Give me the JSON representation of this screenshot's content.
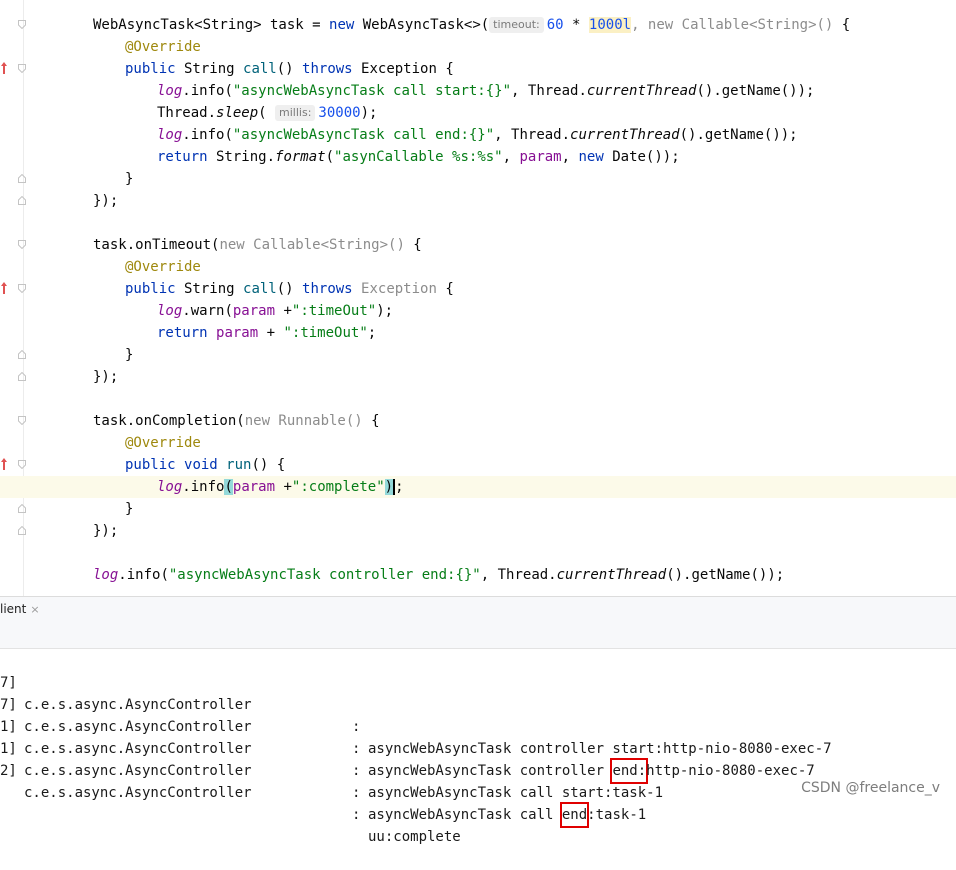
{
  "editor": {
    "lines": {
      "l1": {
        "a": "WebAsyncTask<String> task = ",
        "b": "new",
        "c": " WebAsyncTask<>(",
        "hint": "timeout:",
        "d": "60",
        "e": " * ",
        "f": "1000l",
        "g": ", ",
        "h": "new Callable<String>()",
        "i": " {"
      },
      "l2": {
        "ann": "@Override"
      },
      "l3": {
        "a": "public",
        "b": " String ",
        "c": "call",
        "d": "() ",
        "e": "throws",
        "f": " Exception {"
      },
      "l4": {
        "a": "log",
        "b": ".info(",
        "c": "\"asyncWebAsyncTask call start:{}\"",
        "d": ", Thread.",
        "e": "currentThread",
        "f": "().getName());"
      },
      "l5": {
        "a": "Thread.",
        "b": "sleep",
        "c": "( ",
        "hint": "millis:",
        "d": "30000",
        "e": ");"
      },
      "l6": {
        "a": "log",
        "b": ".info(",
        "c": "\"asyncWebAsyncTask call end:{}\"",
        "d": ", Thread.",
        "e": "currentThread",
        "f": "().getName());"
      },
      "l7": {
        "a": "return",
        "b": " String.",
        "c": "format",
        "d": "(",
        "e": "\"asynCallable %s:%s\"",
        "f": ", ",
        "g": "param",
        "h": ", ",
        "i": "new",
        "j": " Date());"
      },
      "l8": {
        "a": "}"
      },
      "l9": {
        "a": "});"
      },
      "l10": {
        "a": "task.onTimeout(",
        "b": "new Callable<String>()",
        "c": " {"
      },
      "l11": {
        "ann": "@Override"
      },
      "l12": {
        "a": "public",
        "b": " String ",
        "c": "call",
        "d": "() ",
        "e": "throws",
        "f": " Exception",
        "g": " {"
      },
      "l13": {
        "a": "log",
        "b": ".warn(",
        "c": "param",
        "d": " +",
        "e": "\":timeOut\"",
        "f": ");"
      },
      "l14": {
        "a": "return",
        "b": " ",
        "c": "param",
        "d": " + ",
        "e": "\":timeOut\"",
        "f": ";"
      },
      "l15": {
        "a": "}"
      },
      "l16": {
        "a": "});"
      },
      "l17": {
        "a": "task.onCompletion(",
        "b": "new Runnable()",
        "c": " {"
      },
      "l18": {
        "ann": "@Override"
      },
      "l19": {
        "a": "public",
        "b": " ",
        "c": "void",
        "d": " ",
        "e": "run",
        "f": "() {"
      },
      "l20": {
        "a": "log",
        "b": ".info",
        "c": "(",
        "d": "param",
        "e": " +",
        "f": "\":complete\"",
        "g": ")",
        "h": ";"
      },
      "l21": {
        "a": "}"
      },
      "l22": {
        "a": "});"
      },
      "l23": {
        "a": "log",
        "b": ".info(",
        "c": "\"asyncWebAsyncTask controller end:{}\"",
        "d": ", Thread.",
        "e": "currentThread",
        "f": "().getName());"
      }
    }
  },
  "tool_window": {
    "tab_label": "lient",
    "close_glyph": "×"
  },
  "console": {
    "rows": [
      {
        "thread": "7]",
        "logger": "c.e.s.async.AsyncController",
        "colon": ":",
        "msg": "asyncWebAsyncTask controller start:http-nio-8080-exec-7"
      },
      {
        "thread": "7]",
        "logger": "c.e.s.async.AsyncController",
        "colon": ":",
        "msg_pre": "asyncWebAsyncTask controller ",
        "msg_box": "end:",
        "msg_post": "http-nio-8080-exec-7"
      },
      {
        "thread": "1]",
        "logger": "c.e.s.async.AsyncController",
        "colon": ":",
        "msg": "asyncWebAsyncTask call start:task-1"
      },
      {
        "thread": "1]",
        "logger": "c.e.s.async.AsyncController",
        "colon": ":",
        "msg_pre": "asyncWebAsyncTask call ",
        "msg_box": "end",
        "msg_post": ":task-1"
      },
      {
        "thread": "2]",
        "logger": "c.e.s.async.AsyncController",
        "colon": ":",
        "msg": "uu:complete"
      }
    ]
  },
  "watermark": "CSDN @freelance_v",
  "colors": {
    "keyword": "#0033b3",
    "string": "#067d17",
    "number": "#1750eb",
    "annotation": "#9e880d",
    "field": "#871094",
    "override_mark": "#e05252",
    "highlight_box": "#e00000"
  }
}
